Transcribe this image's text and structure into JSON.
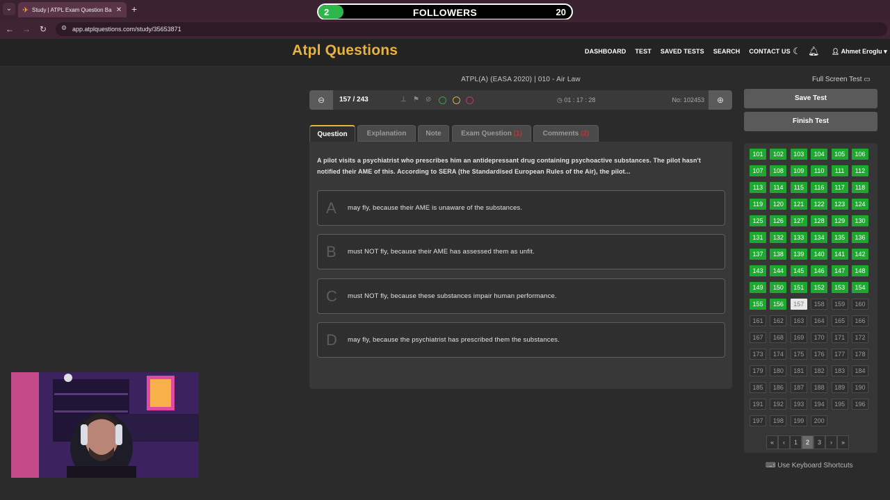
{
  "browser": {
    "tab_title": "Study | ATPL Exam Question Ba",
    "url": "app.atplquestions.com/study/35653871"
  },
  "followers": {
    "current": "2",
    "label": "FOLLOWERS",
    "goal": "20",
    "progress": 0.1
  },
  "app": {
    "logo": "Atpl Questions",
    "menu": [
      "DASHBOARD",
      "TEST",
      "SAVED TESTS",
      "SEARCH",
      "CONTACT US"
    ],
    "user": "Ahmet Eroglu"
  },
  "exam": {
    "subject": "ATPL(A) (EASA 2020) | 010 - Air Law",
    "full_screen": "Full Screen Test",
    "counter": "157 / 243",
    "timer": "01 : 17 : 28",
    "question_no": "No: 102453"
  },
  "tabs": {
    "question": "Question",
    "explanation": "Explanation",
    "note": "Note",
    "exam_question": "Exam Question",
    "exam_question_count": "(1)",
    "comments": "Comments",
    "comments_count": "(2)"
  },
  "question": {
    "text": "A pilot visits a psychiatrist who prescribes him an antidepressant drug containing psychoactive substances. The pilot hasn't notified their AME of this. According to SERA (the Standardised European Rules of the Air), the pilot...",
    "answers": [
      {
        "letter": "A",
        "text": "may fly, because their AME is unaware of the substances."
      },
      {
        "letter": "B",
        "text": "must NOT fly, because their AME has assessed them as unfit."
      },
      {
        "letter": "C",
        "text": "must NOT fly, because these substances impair human performance."
      },
      {
        "letter": "D",
        "text": "may fly, because the psychiatrist has prescribed them the substances."
      }
    ]
  },
  "sidebar": {
    "save": "Save Test",
    "finish": "Finish Test",
    "first_number": 101,
    "last_number": 200,
    "answered_through": 156,
    "current": 157,
    "pager": [
      "«",
      "‹",
      "1",
      "2",
      "3",
      "›",
      "»"
    ],
    "pager_active": "2",
    "shortcuts": "Use Keyboard Shortcuts"
  }
}
